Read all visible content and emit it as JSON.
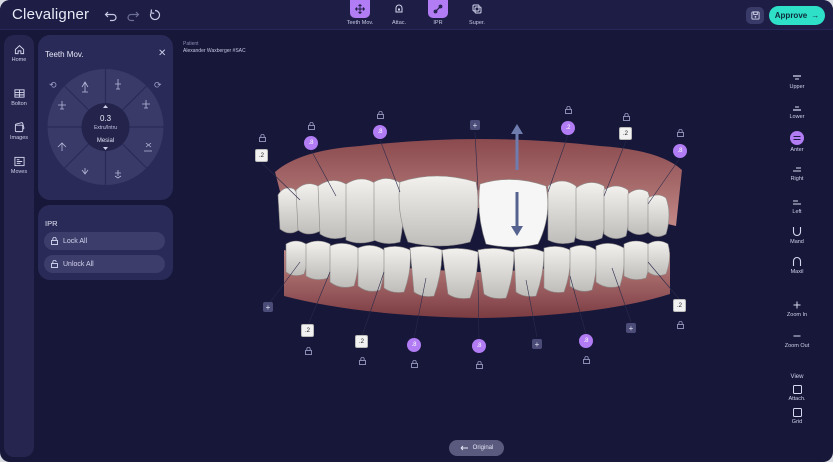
{
  "app": {
    "logo": "Clevaligner"
  },
  "toolbar": {
    "modes": [
      {
        "label": "Teeth Mov.",
        "active": true,
        "icon": "move-icon"
      },
      {
        "label": "Attac.",
        "active": false,
        "icon": "attachment-icon"
      },
      {
        "label": "IPR",
        "active": true,
        "icon": "ipr-icon"
      },
      {
        "label": "Super.",
        "active": false,
        "icon": "superimpose-icon"
      }
    ],
    "approve_label": "Approve",
    "approve_arrow": "→"
  },
  "rail": [
    {
      "label": "Home",
      "icon": "home-icon"
    },
    {
      "label": "Bolton",
      "icon": "table-icon"
    },
    {
      "label": "Images",
      "icon": "images-icon"
    },
    {
      "label": "Moves",
      "icon": "moves-icon"
    }
  ],
  "teeth_panel": {
    "title": "Teeth Mov.",
    "close": "✕",
    "value": "0.3",
    "value_label": "Extru/Intru",
    "direction": "Mesial"
  },
  "ipr_panel": {
    "title": "IPR",
    "lock_all": "Lock All",
    "unlock_all": "Unlock All"
  },
  "patient": {
    "label": "Patient",
    "name": "Alexander Waxberger #SAC"
  },
  "ipr_labels": {
    "upper": [
      ".2",
      ".8",
      ".8",
      "+",
      ".2",
      ".2",
      ".8"
    ],
    "lower": [
      "+",
      ".2",
      ".2",
      ".8",
      ".8",
      "+",
      ".8",
      "+",
      ".2"
    ]
  },
  "right_tools": [
    {
      "label": "Upper",
      "icon": "upper-icon"
    },
    {
      "label": "Lower",
      "icon": "lower-icon"
    },
    {
      "label": "Anter",
      "icon": "anterior-icon",
      "active": true
    },
    {
      "label": "Right",
      "icon": "right-icon"
    },
    {
      "label": "Left",
      "icon": "left-icon"
    },
    {
      "label": "Mand",
      "icon": "mandible-icon"
    },
    {
      "label": "Maxil",
      "icon": "maxilla-icon"
    },
    {
      "label": "Zoom In",
      "icon": "zoom-in-icon"
    },
    {
      "label": "Zoom Out",
      "icon": "zoom-out-icon"
    }
  ],
  "view": {
    "title": "View",
    "attach": "Attach.",
    "grid": "Grid"
  },
  "original_button": "Original",
  "colors": {
    "accent": "#b17cf4",
    "approve": "#2ee0c7",
    "background": "#17173a",
    "panel": "#2a2a58"
  }
}
